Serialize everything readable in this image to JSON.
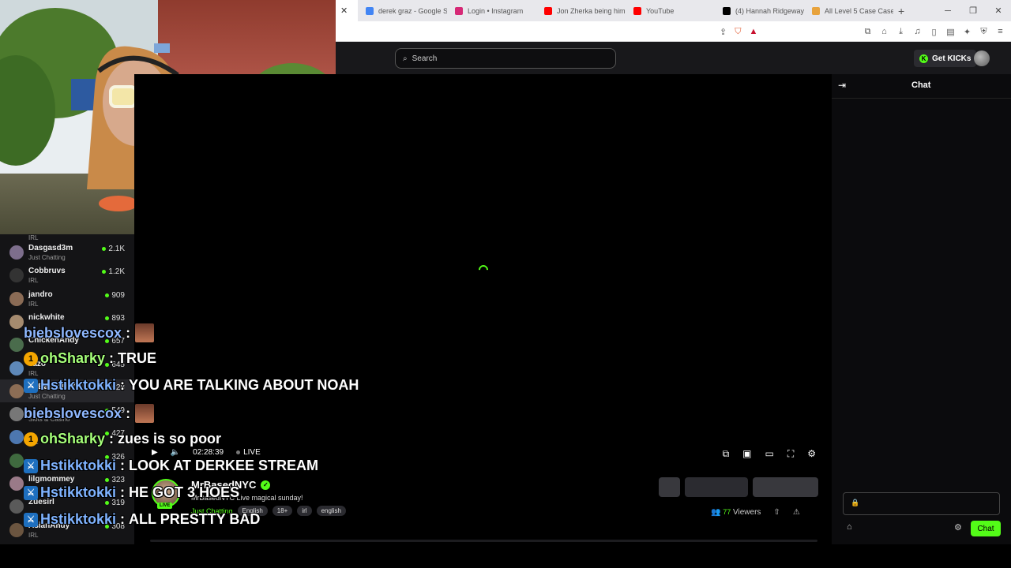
{
  "browser": {
    "tabs": [
      {
        "label": "",
        "active": true,
        "color": "#ffffff"
      },
      {
        "label": "derek graz - Google Se",
        "color": "#4285f4"
      },
      {
        "label": "Login • Instagram",
        "color": "#d62976"
      },
      {
        "label": "Jon Zherka being him",
        "color": "#ff0000"
      },
      {
        "label": "YouTube",
        "color": "#ff0000"
      },
      {
        "label": "(4) Hannah Ridgeway",
        "color": "#000000"
      },
      {
        "label": "All Level 5 Case Case",
        "color": "#e8a33d"
      }
    ],
    "new_tab": "+",
    "win_min": "─",
    "win_max": "❐",
    "win_close": "✕"
  },
  "header": {
    "search_placeholder": "Search",
    "get_kicks": "Get KICKs"
  },
  "sidebar": {
    "cut_top_category": "IRL",
    "items": [
      {
        "name": "Dasgasd3m",
        "category": "Just Chatting",
        "viewers": "2.1K",
        "color": "#7d6e8c"
      },
      {
        "name": "Cobbruvs",
        "category": "IRL",
        "viewers": "1.2K",
        "color": "#333333"
      },
      {
        "name": "jandro",
        "category": "IRL",
        "viewers": "909",
        "color": "#8a6b55"
      },
      {
        "name": "nickwhite",
        "category": "",
        "viewers": "893",
        "color": "#a58b6f"
      },
      {
        "name": "ChickenAndy",
        "category": "",
        "viewers": "657",
        "color": "#4a6c4c"
      },
      {
        "name": "Tazo",
        "category": "IRL",
        "viewers": "645",
        "color": "#5e88b8"
      },
      {
        "name": "MrBasedNYC",
        "category": "Just Chatting",
        "viewers": "628",
        "color": "#8c6d55"
      },
      {
        "name": "",
        "category": "Slots & Casino",
        "viewers": "549",
        "color": "#777777"
      },
      {
        "name": "",
        "category": "IRL",
        "viewers": "427",
        "color": "#4d77b0"
      },
      {
        "name": "",
        "category": "",
        "viewers": "326",
        "color": "#3f6a3f"
      },
      {
        "name": "lilgmommey",
        "category": "",
        "viewers": "323",
        "color": "#9a7a88"
      },
      {
        "name": "Zuesirl",
        "category": "",
        "viewers": "319",
        "color": "#5a5a5a"
      },
      {
        "name": "AsianAndy",
        "category": "IRL",
        "viewers": "308",
        "color": "#6b5540"
      }
    ]
  },
  "player": {
    "time": "02:28:39",
    "live_label": "LIVE",
    "play_icon": "▶",
    "volume_icon": "🔈",
    "ctrl_icons": [
      "⧉",
      "▣",
      "▭",
      "⛶",
      "⚙"
    ]
  },
  "stream": {
    "live_badge": "LIVE",
    "streamer": "MrBasedNYC",
    "title": "MrBasedNYC Live magical sunday!",
    "category": "Just Chatting",
    "tags": [
      "English",
      "18+",
      "irl",
      "english"
    ],
    "viewer_count": "77",
    "viewers_label": "Viewers"
  },
  "chat": {
    "title": "Chat",
    "send_label": "Chat"
  },
  "overlay_chat": [
    {
      "user": "biebslovescox",
      "sep": " :",
      "msg": "",
      "badge": "",
      "user_class": "c-bieb",
      "emote": true
    },
    {
      "user": "ohSharky",
      "sep": " : ",
      "msg": "TRUE",
      "badge": "1",
      "user_class": "c-sharky",
      "emote": false
    },
    {
      "user": "Hstikktokki",
      "sep": " : ",
      "msg": "YOU ARE TALKING ABOUT NOAH",
      "badge": "⚔",
      "user_class": "c-hst",
      "emote": false
    },
    {
      "user": "biebslovescox",
      "sep": " :",
      "msg": "",
      "badge": "",
      "user_class": "c-bieb",
      "emote": true
    },
    {
      "user": "ohSharky",
      "sep": " : ",
      "msg": "zues is so poor",
      "badge": "1",
      "user_class": "c-sharky",
      "emote": false
    },
    {
      "user": "Hstikktokki",
      "sep": " : ",
      "msg": "LOOK AT DERKEE STREAM",
      "badge": "⚔",
      "user_class": "c-hst",
      "emote": false
    },
    {
      "user": "Hstikktokki",
      "sep": " : ",
      "msg": "HE GOT 3 HOES",
      "badge": "⚔",
      "user_class": "c-hst",
      "emote": false
    },
    {
      "user": "Hstikktokki",
      "sep": " : ",
      "msg": "ALL PRESTTY BAD",
      "badge": "⚔",
      "user_class": "c-hst",
      "emote": false
    }
  ]
}
